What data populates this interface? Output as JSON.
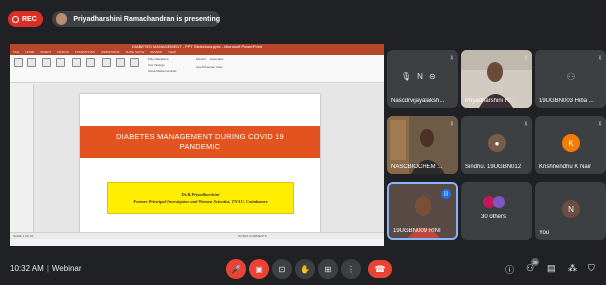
{
  "topbar": {
    "rec_label": "REC",
    "presenting_text": "Priyadharshini Ramachandran is presenting"
  },
  "presentation": {
    "window_title": "DIABETES MANAGEMENT - PPT Slideshow.pptx - Microsoft PowerPoint",
    "tabs": [
      "FILE",
      "HOME",
      "INSERT",
      "DESIGN",
      "TRANSITIONS",
      "ANIMATIONS",
      "SLIDE SHOW",
      "REVIEW",
      "VIEW"
    ],
    "ribbon_checks": [
      "Play Narrations",
      "Use Timings",
      "Show Media Controls",
      "Use Presenter View"
    ],
    "ribbon_monitor_label": "Monitor:",
    "ribbon_monitor_value": "Automatic",
    "slide_title_line1": "DIABETES MANAGEMENT DURING COVID 19",
    "slide_title_line2": "PANDEMIC",
    "slide_name": "Dr.R.Priyadharshini",
    "slide_role": "Former Principal Investigator and Women Scientist, TNAU, Coimbatore",
    "status_left": "SLIDE 1 OF 20",
    "status_right": "NOTES  COMMENTS"
  },
  "participants": [
    {
      "name": "Nascdrvijayalaksh...",
      "avatar_letter": "",
      "kind": "muted"
    },
    {
      "name": "Priyadharshini R...",
      "kind": "photo"
    },
    {
      "name": "19UGBN003 Hiba ...",
      "kind": "icon"
    },
    {
      "name": "NASCBIOCHEM ...",
      "kind": "photo"
    },
    {
      "name": "Sindhu. 19UGBN012",
      "kind": "avatar-photo"
    },
    {
      "name": "Krishnendhu K Nair",
      "avatar_letter": "K",
      "kind": "letter",
      "color": "#f57c00"
    },
    {
      "name": "19UGBN009 RINI",
      "kind": "photo-active"
    },
    {
      "name": "30 others",
      "kind": "others"
    },
    {
      "name": "You",
      "avatar_letter": "N",
      "kind": "letter",
      "color": "#6d4c41"
    }
  ],
  "bottombar": {
    "time": "10:32 AM",
    "meeting_name": "Webinar",
    "people_count": "38"
  },
  "colors": {
    "rec": "#d93025",
    "slide_band": "#e2531f",
    "slide_box": "#ffee00",
    "end_call": "#ea4335",
    "speaking": "#1a73e8"
  }
}
